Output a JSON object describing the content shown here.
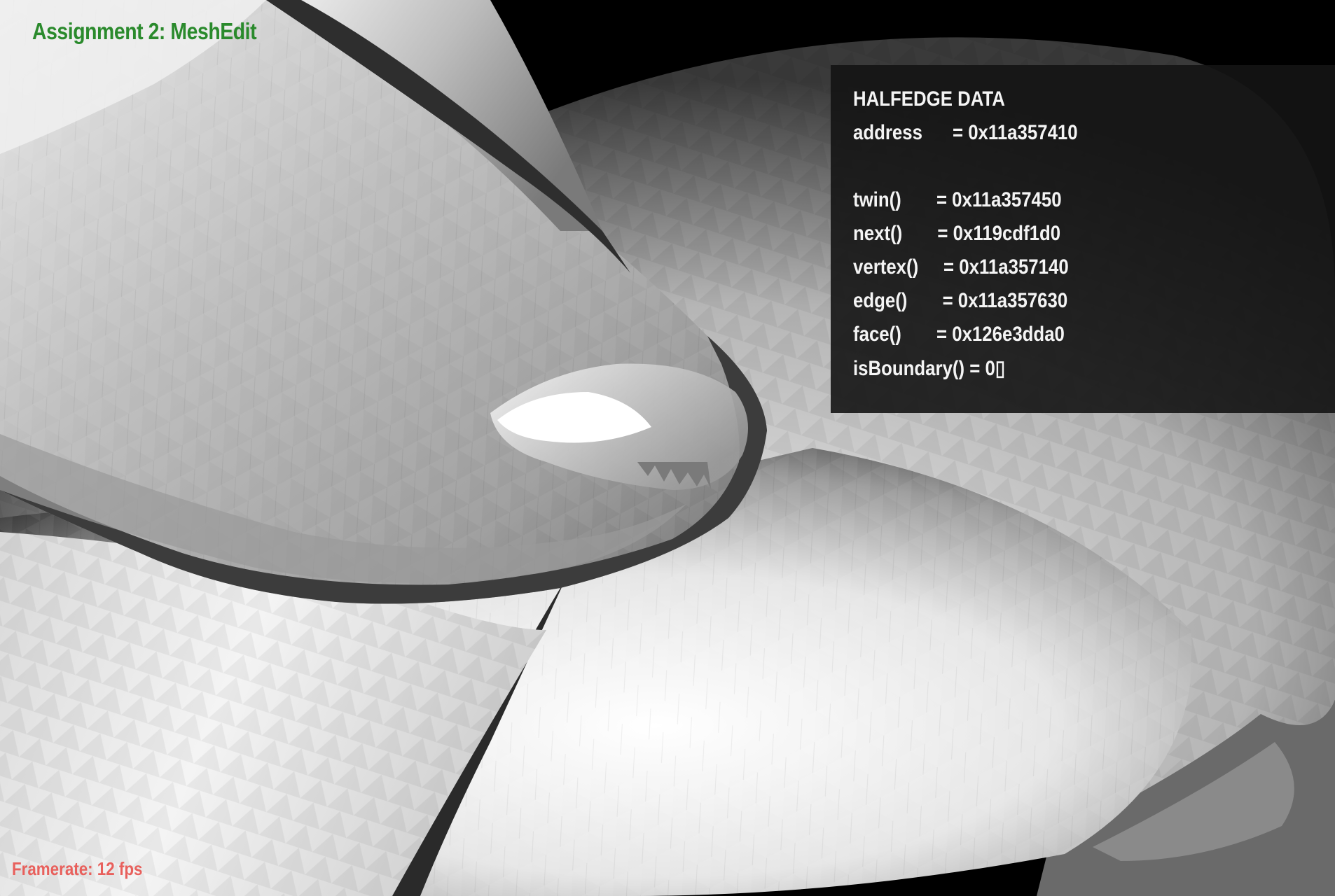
{
  "app": {
    "title": "Assignment 2: MeshEdit",
    "background_color": "#000000",
    "title_color": "#2a8a2c"
  },
  "viewport": {
    "description_icon": "mesh-bunny-render"
  },
  "halfedge_panel": {
    "heading": "HALFEDGE DATA",
    "address_line": "address      = 0x11a357410",
    "twin_line": "twin()       = 0x11a357450",
    "next_line": "next()       = 0x119cdf1d0",
    "vertex_line": "vertex()     = 0x11a357140",
    "edge_line": "edge()       = 0x11a357630",
    "face_line": "face()       = 0x126e3dda0",
    "boundary_line": "isBoundary() = 0▯"
  },
  "status": {
    "framerate": "Framerate: 12 fps",
    "framerate_color": "#e8605c"
  }
}
